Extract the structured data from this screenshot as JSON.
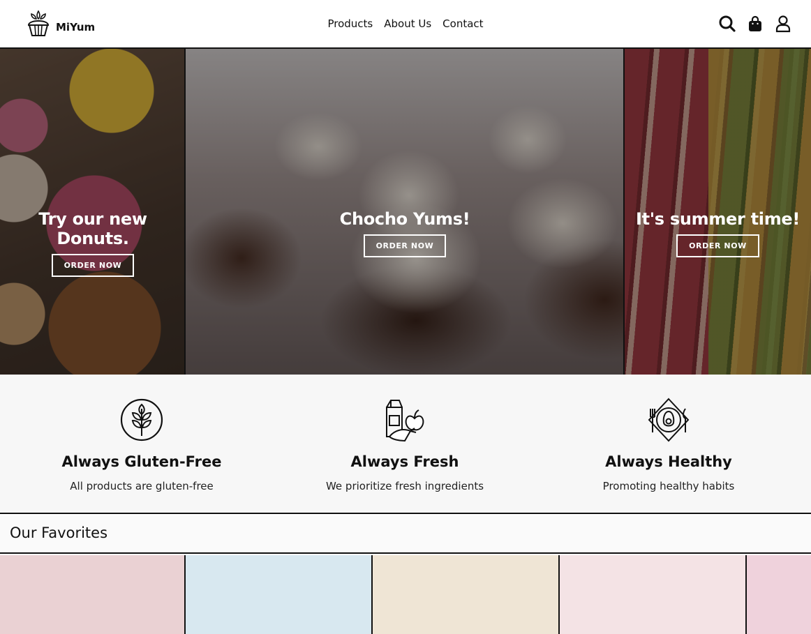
{
  "brand": {
    "name": "MiYum"
  },
  "nav": {
    "items": [
      "Products",
      "About Us",
      "Contact"
    ]
  },
  "header_icons": [
    "search-icon",
    "shopping-bag-icon",
    "user-icon"
  ],
  "hero": {
    "panels": [
      {
        "title": "Try our new Donuts.",
        "button": "ORDER NOW"
      },
      {
        "title": "Chocho Yums!",
        "button": "ORDER NOW"
      },
      {
        "title": "It's summer time!",
        "button": "ORDER NOW"
      }
    ]
  },
  "features": [
    {
      "icon": "leaf-icon",
      "title": "Always Gluten-Free",
      "text": "All products are gluten-free"
    },
    {
      "icon": "fresh-produce-icon",
      "title": "Always Fresh",
      "text": "We prioritize fresh ingredients"
    },
    {
      "icon": "healthy-plate-icon",
      "title": "Always Healthy",
      "text": "Promoting healthy habits"
    }
  ],
  "favorites": {
    "title": "Our Favorites",
    "card_colors": [
      "#ead1d3",
      "#d8e8f0",
      "#efe5d5",
      "#f4e3e5",
      "#efd2dc"
    ]
  },
  "colors": {
    "accent": "#111111",
    "overlay": "rgba(0,0,0,0.38)",
    "section_bg": "#f7f7f7"
  }
}
